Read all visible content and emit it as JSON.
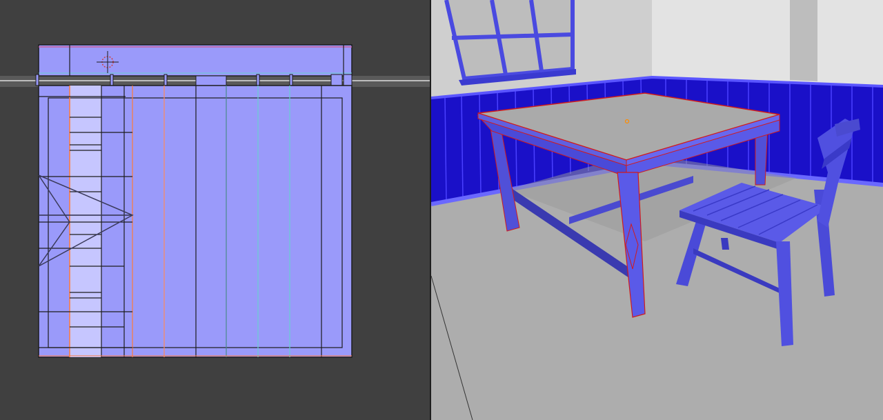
{
  "app": {
    "name": "",
    "panels": [
      {
        "id": "uv_editor",
        "label": ""
      },
      {
        "id": "viewport_3d",
        "label": ""
      }
    ]
  },
  "colors": {
    "editor_background": "#404040",
    "uv_fill": "#9b9bfa",
    "uv_fill_light": "#c8c8ff",
    "uv_edge": "#1a1a1a",
    "uv_seam": "#ff7b3a",
    "mesh_normal_blue": "#1a10c8",
    "mesh_normal_violet": "#4a4ae0",
    "selection_outline": "#d21a1a",
    "wall": "#d6d6d6",
    "floor": "#a8a8a8",
    "origin_marker": "#ff8c00"
  },
  "uv_editor": {
    "cursor_icon": "2d-cursor-icon"
  },
  "viewport": {
    "objects": [
      "window",
      "wall",
      "wainscot-paneling",
      "table",
      "chair"
    ],
    "selected_object": "table",
    "origin_icon": "object-origin-icon"
  }
}
